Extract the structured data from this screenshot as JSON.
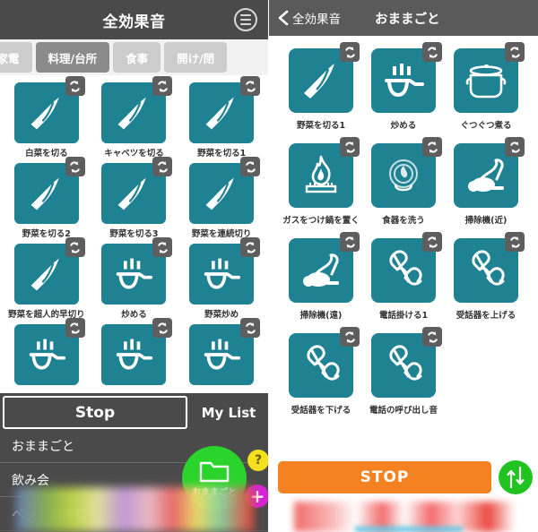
{
  "colors": {
    "tile_teal": "#1f8293",
    "header_gray": "#4a4a4a",
    "badge_gray": "#5e5e5e",
    "stop_orange": "#f58220",
    "fab_green": "#2bd42b",
    "sort_green": "#21c321",
    "help_yellow": "#f5e01e",
    "add_magenta": "#d423d4"
  },
  "left": {
    "header": {
      "title": "全効果音",
      "menu_icon": "hamburger-icon"
    },
    "tabs": [
      {
        "label": "活家電",
        "active": false,
        "clipped": true
      },
      {
        "label": "料理/台所",
        "active": true,
        "clipped": false
      },
      {
        "label": "食事",
        "active": false,
        "clipped": false
      },
      {
        "label": "開け/閉",
        "active": false,
        "clipped": true
      }
    ],
    "grid": [
      {
        "label": "白菜を切る",
        "icon": "knife-icon",
        "loop": "loop-icon"
      },
      {
        "label": "キャベツを切る",
        "icon": "knife-icon",
        "loop": "loop-icon"
      },
      {
        "label": "野菜を切る1",
        "icon": "knife-icon",
        "loop": "loop-icon"
      },
      {
        "label": "野菜を切る2",
        "icon": "knife-icon",
        "loop": "loop-icon"
      },
      {
        "label": "野菜を切る3",
        "icon": "knife-icon",
        "loop": "loop-icon"
      },
      {
        "label": "野菜を連続切り",
        "icon": "knife-icon",
        "loop": "loop-icon"
      },
      {
        "label": "野菜を超人的早切り",
        "icon": "knife-icon",
        "loop": "loop-icon"
      },
      {
        "label": "炒める",
        "icon": "frying-pan-icon",
        "loop": "loop-icon"
      },
      {
        "label": "野菜炒め",
        "icon": "frying-pan-icon",
        "loop": "loop-icon"
      },
      {
        "label": "",
        "icon": "frying-pan-icon",
        "loop": "loop-icon"
      },
      {
        "label": "",
        "icon": "frying-pan-icon",
        "loop": "loop-icon"
      },
      {
        "label": "",
        "icon": "frying-pan-icon",
        "loop": "loop-icon"
      }
    ],
    "bottom": {
      "stop_label": "Stop",
      "mylist_label": "My List",
      "list_items": [
        {
          "label": "おままごと",
          "faded": false
        },
        {
          "label": "飲み会",
          "faded": false
        },
        {
          "label": "ペット効果音",
          "faded": true
        }
      ],
      "fab": {
        "label": "おままごと",
        "icon": "folder-icon"
      },
      "help_badge": "?",
      "add_badge": "+"
    }
  },
  "right": {
    "header": {
      "back_icon": "chevron-left-icon",
      "back_label": "全効果音",
      "title": "おままごと"
    },
    "grid": [
      {
        "label": "野菜を切る1",
        "icon": "knife-icon",
        "loop": "loop-icon"
      },
      {
        "label": "炒める",
        "icon": "frying-pan-icon",
        "loop": "loop-icon"
      },
      {
        "label": "ぐつぐつ煮る",
        "icon": "pot-icon",
        "loop": "loop-icon"
      },
      {
        "label": "ガスをつけ鍋を置く",
        "icon": "flame-icon",
        "loop": "loop-icon"
      },
      {
        "label": "食器を洗う",
        "icon": "dish-wash-icon",
        "loop": "loop-icon"
      },
      {
        "label": "掃除機(近)",
        "icon": "vacuum-icon",
        "loop": "loop-icon"
      },
      {
        "label": "掃除機(遠)",
        "icon": "vacuum-icon",
        "loop": "loop-icon"
      },
      {
        "label": "電話掛ける1",
        "icon": "phone-handset-icon",
        "loop": "loop-icon"
      },
      {
        "label": "受話器を上げる",
        "icon": "phone-handset-icon",
        "loop": "loop-icon"
      },
      {
        "label": "受話器を下げる",
        "icon": "phone-handset-icon",
        "loop": "loop-icon"
      },
      {
        "label": "電話の呼び出し音",
        "icon": "phone-handset-icon",
        "loop": "loop-icon"
      }
    ],
    "bottom": {
      "stop_label": "STOP",
      "sort_icon": "sort-updown-icon"
    }
  }
}
